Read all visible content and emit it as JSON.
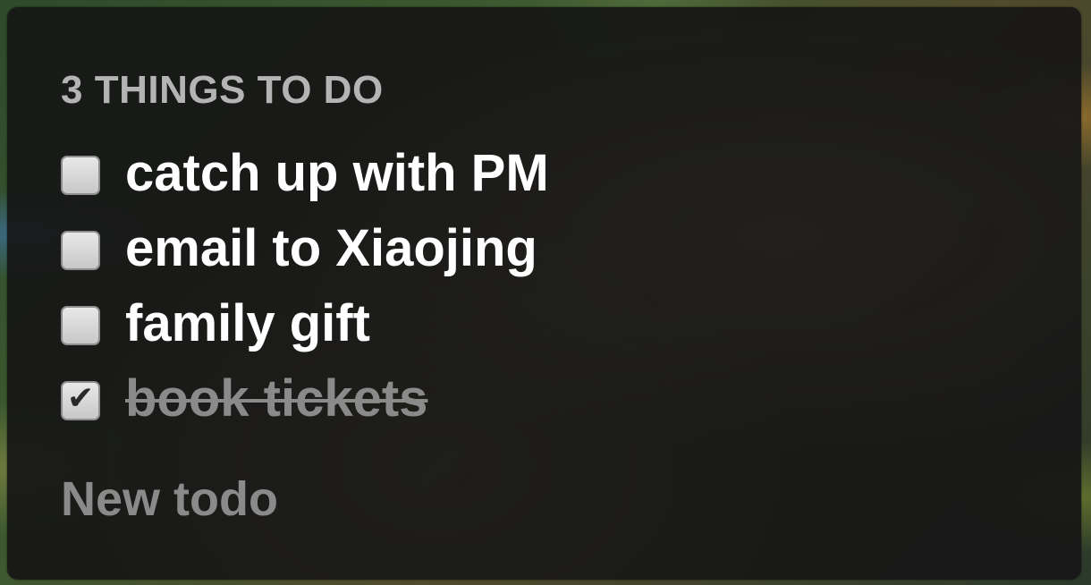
{
  "header": {
    "title": "3 THINGS TO DO"
  },
  "todos": [
    {
      "text": "catch up with PM",
      "done": false
    },
    {
      "text": "email to Xiaojing",
      "done": false
    },
    {
      "text": "family gift",
      "done": false
    },
    {
      "text": "book tickets",
      "done": true
    }
  ],
  "new_todo": {
    "placeholder": "New todo",
    "value": ""
  },
  "icons": {
    "check": "check-icon"
  },
  "colors": {
    "panel_background": "#171717",
    "title": "#b4b4b4",
    "todo_text": "#ffffff",
    "done_text": "#8a8a8a"
  }
}
